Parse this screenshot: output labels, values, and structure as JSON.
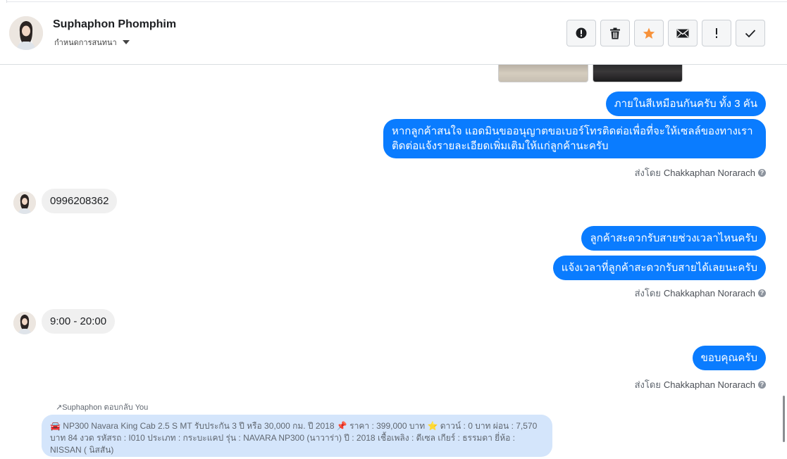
{
  "header": {
    "contact_name": "Suphaphon Phomphim",
    "assign_label": "กำหนดการสนทนา",
    "actions": [
      {
        "name": "report-button",
        "icon": "alert-circle-icon"
      },
      {
        "name": "delete-button",
        "icon": "trash-icon"
      },
      {
        "name": "star-button",
        "icon": "star-icon"
      },
      {
        "name": "mark-unread-button",
        "icon": "envelope-icon"
      },
      {
        "name": "important-button",
        "icon": "exclamation-icon"
      },
      {
        "name": "mark-done-button",
        "icon": "check-icon"
      }
    ],
    "star_color": "#f7923a"
  },
  "thread": {
    "outgoing_group_1": [
      "ภายในสีเหมือนกันครับ ทั้ง 3 คัน",
      "หากลูกค้าสนใจ แอดมินขออนุญาตขอเบอร์โทรติดต่อเพื่อที่จะให้เซลล์ของทางเราติดต่อแจ้งรายละเอียดเพิ่มเติมให้แก่ลูกค้านะครับ"
    ],
    "sent_by_prefix": "ส่งโดย",
    "agent_name": "Chakkaphan Norarach",
    "incoming_1": "0996208362",
    "outgoing_group_2": [
      "ลูกค้าสะดวกรับสายช่วงเวลาไหนครับ",
      "แจ้งเวลาที่ลูกค้าสะดวกรับสายได้เลยนะครับ"
    ],
    "incoming_2": "9:00 - 20:00",
    "outgoing_3": "ขอบคุณครับ",
    "reply": {
      "label": "Suphaphon ตอบกลับ You",
      "text": "🚘 NP300 Navara King Cab 2.5 S MT รับประกัน 3 ปี หรือ 30,000 กม. ปี 2018 📌 ราคา : 399,000 บาท ⭐ ดาวน์ : 0 บาท ผ่อน : 7,570 บาท 84 งวด รหัสรถ : I010 ประเภท : กระบะแคป รุ่น : NAVARA NP300 (นาวาร่า) ปี : 2018 เชื้อเพลิง : ดีเซล เกียร์ : ธรรมดา ยี่ห้อ : NISSAN ( นิสสัน)"
    }
  },
  "colors": {
    "outgoing_bubble": "#0a7cff",
    "incoming_bubble": "#f0f0f0",
    "reply_bubble": "#d4e5fb"
  }
}
